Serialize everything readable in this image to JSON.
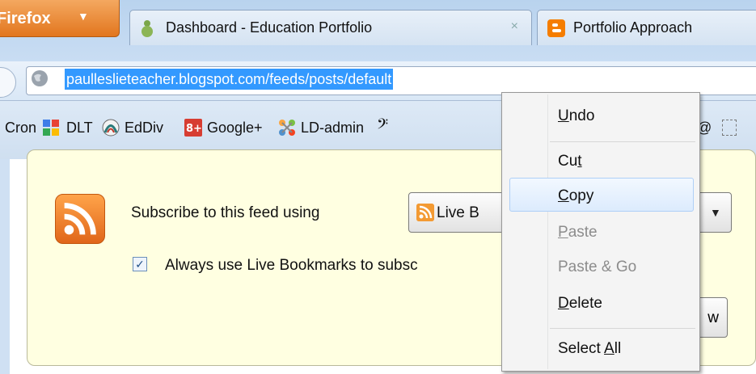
{
  "browser": {
    "menu_button": "Firefox",
    "tabs": [
      {
        "title": "Dashboard - Education Portfolio",
        "close": "×"
      },
      {
        "title": "Portfolio Approach"
      }
    ]
  },
  "address_bar": {
    "url": "paulleslieteacher.blogspot.com/feeds/posts/default"
  },
  "bookmarks": [
    {
      "label": "Cron"
    },
    {
      "label": "DLT"
    },
    {
      "label": "EdDiv"
    },
    {
      "label": "Google+"
    },
    {
      "label": "LD-admin"
    }
  ],
  "feed": {
    "subscribe_label": "Subscribe to this feed using",
    "reader_selected": "Live B",
    "always_use_label": "Always use Live Bookmarks to subsc",
    "always_use_checked": true,
    "subscribe_button_partial": "w"
  },
  "context_menu": {
    "items": [
      {
        "pre": "",
        "key": "U",
        "post": "ndo",
        "enabled": true
      },
      {
        "pre": "Cu",
        "key": "t",
        "post": "",
        "enabled": true
      },
      {
        "pre": "",
        "key": "C",
        "post": "opy",
        "enabled": true,
        "highlighted": true
      },
      {
        "pre": "",
        "key": "P",
        "post": "aste",
        "enabled": false
      },
      {
        "pre": "Paste & Go",
        "key": "",
        "post": "",
        "enabled": false
      },
      {
        "pre": "",
        "key": "D",
        "post": "elete",
        "enabled": true
      },
      {
        "pre": "Select ",
        "key": "A",
        "post": "ll",
        "enabled": true
      }
    ]
  },
  "colors": {
    "selection": "#3399ff",
    "firefox_orange": "#e2761e",
    "feed_panel": "#ffffe1",
    "rss_orange": "#f39a33"
  }
}
